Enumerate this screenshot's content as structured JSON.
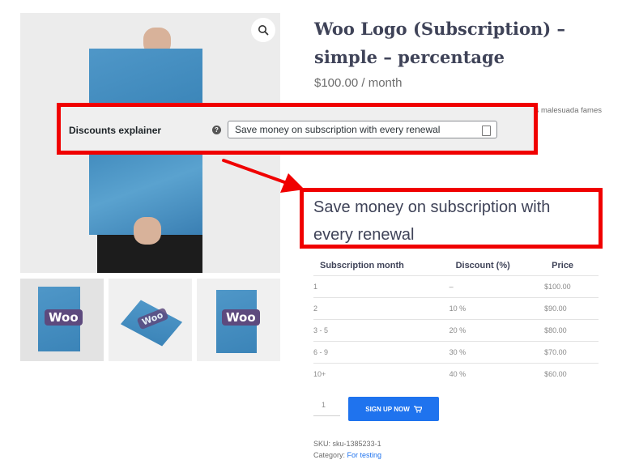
{
  "product": {
    "title": "Woo Logo (Subscription) – simple – percentage",
    "price": "$100.00 / month",
    "description": "fames ac turpis malesuada fames"
  },
  "gallery": {
    "thumbnail_logo_text": "Woo"
  },
  "admin_setting": {
    "label": "Discounts explainer",
    "help_icon": "question-circle-icon",
    "input_value": "Save money on subscription with every renewal",
    "field_icon": "clipboard-icon"
  },
  "explainer": {
    "text": "Save money on subscription with every renewal"
  },
  "discount_table": {
    "headers": [
      "Subscription month",
      "Discount (%)",
      "Price"
    ],
    "rows": [
      [
        "1",
        "–",
        "$100.00"
      ],
      [
        "2",
        "10 %",
        "$90.00"
      ],
      [
        "3 - 5",
        "20 %",
        "$80.00"
      ],
      [
        "6 - 9",
        "30 %",
        "$70.00"
      ],
      [
        "10+",
        "40 %",
        "$60.00"
      ]
    ]
  },
  "cart": {
    "quantity": "1",
    "signup_label": "SIGN UP NOW",
    "cart_icon": "cart-icon"
  },
  "meta": {
    "sku_label": "SKU:",
    "sku_value": "sku-1385233-1",
    "category_label": "Category:",
    "category_value": "For testing"
  },
  "colors": {
    "highlight": "#f00000",
    "button": "#1f73ee",
    "title": "#3f4358"
  }
}
